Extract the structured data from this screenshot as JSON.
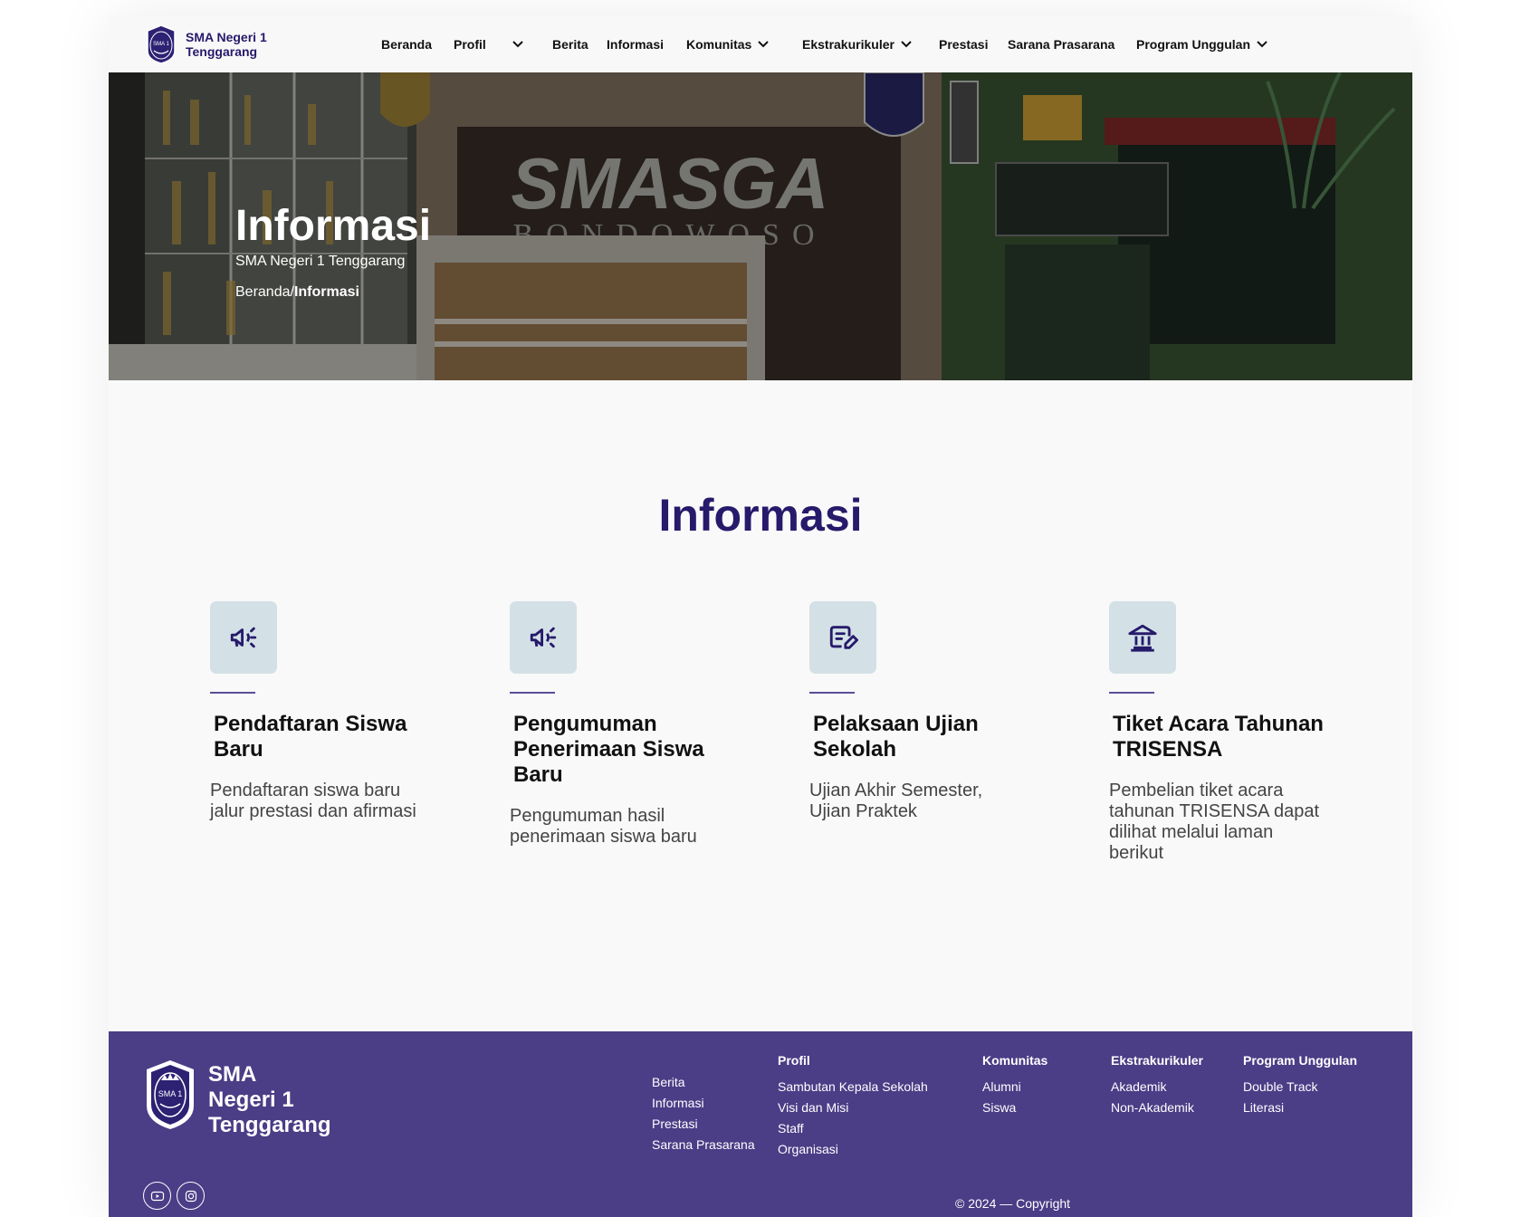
{
  "brand": {
    "name_line1": "SMA Negeri 1",
    "name_line2": "Tenggarang"
  },
  "nav": [
    {
      "label": "Beranda",
      "has_dropdown": false
    },
    {
      "label": "Profil",
      "has_dropdown": true
    },
    {
      "label": "Berita",
      "has_dropdown": false
    },
    {
      "label": "Informasi",
      "has_dropdown": false
    },
    {
      "label": "Komunitas",
      "has_dropdown": true
    },
    {
      "label": "Ekstrakurikuler",
      "has_dropdown": true
    },
    {
      "label": "Prestasi",
      "has_dropdown": false
    },
    {
      "label": "Sarana Prasarana",
      "has_dropdown": false
    },
    {
      "label": "Program Unggulan",
      "has_dropdown": true
    }
  ],
  "hero": {
    "title": "Informasi",
    "subtitle": "SMA Negeri 1 Tenggarang",
    "breadcrumb_home": "Beranda",
    "breadcrumb_sep": "/",
    "breadcrumb_current": "Informasi",
    "sign_text": "SMASGA",
    "sign_sub": "BONDOWOSO"
  },
  "section": {
    "title": "Informasi",
    "cards": [
      {
        "icon": "megaphone-icon",
        "title": "Pendaftaran Siswa Baru",
        "desc": "Pendaftaran siswa baru jalur prestasi dan afirmasi"
      },
      {
        "icon": "megaphone-icon",
        "title": "Pengumuman Penerimaan Siswa Baru",
        "desc": "Pengumuman hasil penerimaan siswa baru"
      },
      {
        "icon": "exam-edit-icon",
        "title": "Pelaksaan Ujian Sekolah",
        "desc": "Ujian Akhir Semester, Ujian Praktek"
      },
      {
        "icon": "building-icon",
        "title": "Tiket Acara Tahunan TRISENSA",
        "desc": "Pembelian tiket acara tahunan TRISENSA dapat dilihat melalui laman berikut"
      }
    ]
  },
  "footer": {
    "brand_line1": "SMA",
    "brand_line2": "Negeri 1",
    "brand_line3": "Tenggarang",
    "links": [
      "Berita",
      "Informasi",
      "Prestasi",
      "Sarana Prasarana"
    ],
    "columns": [
      {
        "head": "Profil",
        "items": [
          "Sambutan Kepala Sekolah",
          "Visi dan Misi",
          "Staff",
          "Organisasi"
        ]
      },
      {
        "head": "Komunitas",
        "items": [
          "Alumni",
          "Siswa"
        ]
      },
      {
        "head": "Ekstrakurikuler",
        "items": [
          "Akademik",
          "Non-Akademik"
        ]
      },
      {
        "head": "Program Unggulan",
        "items": [
          "Double Track",
          "Literasi"
        ]
      }
    ],
    "copyright": "© 2024 — Copyright"
  },
  "colors": {
    "brand": "#261a6b",
    "footer": "#4b3d86",
    "icon_bg": "#d3e1e6"
  }
}
